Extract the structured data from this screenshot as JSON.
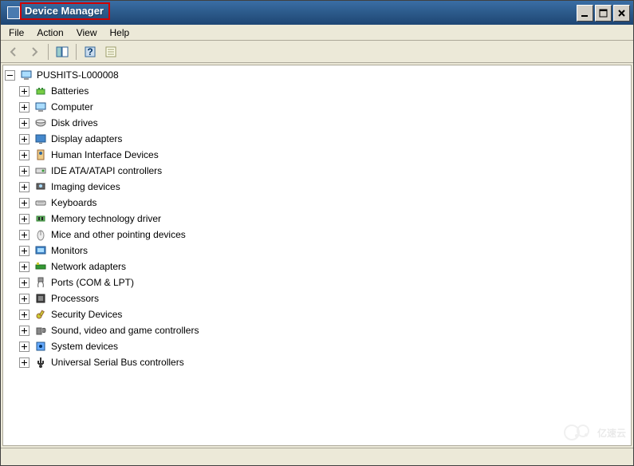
{
  "window": {
    "title": "Device Manager"
  },
  "menu": {
    "file": "File",
    "action": "Action",
    "view": "View",
    "help": "Help"
  },
  "tree": {
    "root": "PUSHITS-L000008",
    "items": [
      "Batteries",
      "Computer",
      "Disk drives",
      "Display adapters",
      "Human Interface Devices",
      "IDE ATA/ATAPI controllers",
      "Imaging devices",
      "Keyboards",
      "Memory technology driver",
      "Mice and other pointing devices",
      "Monitors",
      "Network adapters",
      "Ports (COM & LPT)",
      "Processors",
      "Security Devices",
      "Sound, video and game controllers",
      "System devices",
      "Universal Serial Bus controllers"
    ]
  },
  "watermark": "亿速云"
}
